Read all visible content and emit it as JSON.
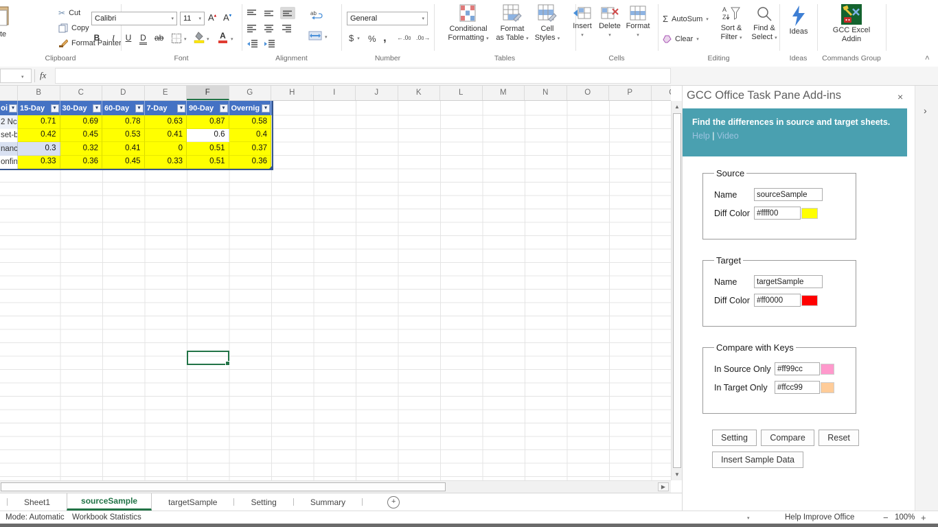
{
  "ribbon": {
    "clipboard": {
      "group_label": "Clipboard",
      "paste_partial": "te",
      "cut": "Cut",
      "copy": "Copy",
      "format_painter": "Format Painter"
    },
    "font": {
      "group_label": "Font",
      "name": "Calibri",
      "size": "11",
      "bold": "B",
      "italic": "I",
      "underline": "U",
      "double_underline": "D",
      "strikethrough": "ab"
    },
    "alignment": {
      "group_label": "Alignment"
    },
    "number": {
      "group_label": "Number",
      "format": "General",
      "currency": "$",
      "percent": "%",
      "comma": ","
    },
    "tables": {
      "group_label": "Tables",
      "cf_line1": "Conditional",
      "cf_line2": "Formatting",
      "fat_line1": "Format",
      "fat_line2": "as Table",
      "cs_line1": "Cell",
      "cs_line2": "Styles"
    },
    "cells": {
      "group_label": "Cells",
      "insert": "Insert",
      "delete": "Delete",
      "format": "Format"
    },
    "editing": {
      "group_label": "Editing",
      "autosum": "AutoSum",
      "clear": "Clear",
      "sf_line1": "Sort &",
      "sf_line2": "Filter",
      "fs_line1": "Find &",
      "fs_line2": "Select"
    },
    "ideas": {
      "group_label": "Ideas",
      "button": "Ideas"
    },
    "commands": {
      "group_label": "Commands Group",
      "line1": "GCC Excel",
      "line2": "Addin"
    }
  },
  "formula_bar": {
    "fx": "fx"
  },
  "grid": {
    "columns": [
      "B",
      "C",
      "D",
      "E",
      "F",
      "G",
      "H",
      "I",
      "J",
      "K",
      "L",
      "M",
      "N",
      "O",
      "P",
      "Q"
    ],
    "selected_column": "F",
    "table": {
      "colA_header_partial": "oi",
      "headers": [
        "15-Day",
        "30-Day",
        "60-Day",
        "7-Day",
        "90-Day",
        "Overnig"
      ],
      "rows": [
        {
          "label": "2 Nc",
          "values": [
            "0.71",
            "0.69",
            "0.78",
            "0.63",
            "0.87",
            "0.58"
          ]
        },
        {
          "label": "set-b",
          "values": [
            "0.42",
            "0.45",
            "0.53",
            "0.41",
            "0.6",
            "0.4"
          ]
        },
        {
          "label": "nanci",
          "values": [
            "0.3",
            "0.32",
            "0.41",
            "0",
            "0.51",
            "0.37"
          ]
        },
        {
          "label": "onfin",
          "values": [
            "0.33",
            "0.36",
            "0.45",
            "0.33",
            "0.51",
            "0.36"
          ]
        }
      ]
    }
  },
  "task_pane": {
    "title": "GCC Office Task Pane Add-ins",
    "banner": {
      "text": "Find the differences in source and target sheets.",
      "help_link": "Help",
      "separator": "|",
      "video_link": "Video"
    },
    "source": {
      "legend": "Source",
      "name_label": "Name",
      "name_value": "sourceSample",
      "diff_color_label": "Diff Color",
      "diff_color_value": "#ffff00"
    },
    "target": {
      "legend": "Target",
      "name_label": "Name",
      "name_value": "targetSample",
      "diff_color_label": "Diff Color",
      "diff_color_value": "#ff0000"
    },
    "compare_keys": {
      "legend": "Compare with Keys",
      "in_source_label": "In Source Only",
      "in_source_value": "#ff99cc",
      "in_target_label": "In Target Only",
      "in_target_value": "#ffcc99"
    },
    "buttons": {
      "setting": "Setting",
      "compare": "Compare",
      "reset": "Reset",
      "insert_sample": "Insert Sample Data"
    }
  },
  "sheet_tabs": {
    "sheet1": "Sheet1",
    "source_sample": "sourceSample",
    "target_sample": "targetSample",
    "setting": "Setting",
    "summary": "Summary"
  },
  "status_bar": {
    "mode": "Mode: Automatic",
    "stats": "Workbook Statistics",
    "help": "Help Improve Office",
    "zoom_level": "100%"
  },
  "colors": {
    "excel_green": "#217346",
    "table_header_blue": "#4472c4",
    "banded_row": "#d9e1f2",
    "source_diff": "#ffff00",
    "target_diff": "#ff0000",
    "in_source_only": "#ff99cc",
    "in_target_only": "#ffcc99",
    "banner_teal": "#4aa0b0"
  }
}
